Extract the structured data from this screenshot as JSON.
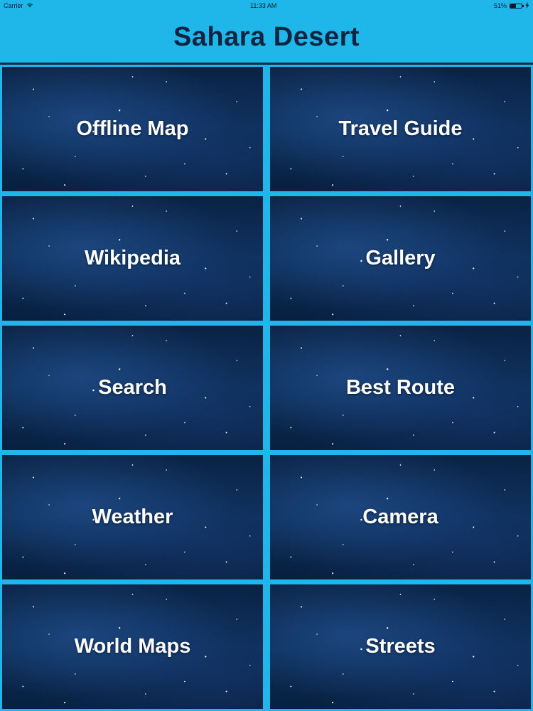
{
  "status_bar": {
    "carrier": "Carrier",
    "time": "11:33 AM",
    "battery": "51%",
    "battery_level": 0.51,
    "wifi_icon": "wifi-icon",
    "battery_icon": "battery-icon",
    "charging_icon": "charging-bolt-icon"
  },
  "header": {
    "title": "Sahara Desert"
  },
  "colors": {
    "header_bg": "#1fb6ea",
    "title_text": "#0d2540",
    "tile_bg": "#0c2d55",
    "tile_text": "#ffffff"
  },
  "menu": {
    "tiles": [
      {
        "label": "Offline Map"
      },
      {
        "label": "Travel Guide"
      },
      {
        "label": "Wikipedia"
      },
      {
        "label": "Gallery"
      },
      {
        "label": "Search"
      },
      {
        "label": "Best Route"
      },
      {
        "label": "Weather"
      },
      {
        "label": "Camera"
      },
      {
        "label": "World Maps"
      },
      {
        "label": "Streets"
      }
    ]
  }
}
